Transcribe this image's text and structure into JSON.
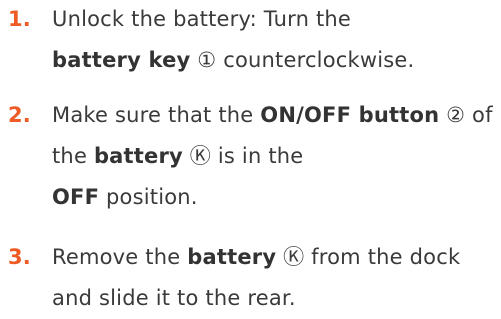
{
  "accent_color": "#ef5b24",
  "steps": [
    {
      "number": "1.",
      "parts": [
        {
          "text": "Unlock the battery: Turn the ",
          "bold": false
        },
        {
          "text": "battery key",
          "bold": true
        },
        {
          "text": " ① counterclockwise.",
          "bold": false
        }
      ]
    },
    {
      "number": "2.",
      "parts": [
        {
          "text": "Make sure that the ",
          "bold": false
        },
        {
          "text": "ON/OFF button",
          "bold": true
        },
        {
          "text": " ② of the ",
          "bold": false
        },
        {
          "text": "battery",
          "bold": true
        },
        {
          "text": " Ⓚ is in the ",
          "bold": false
        },
        {
          "text": "OFF",
          "bold": true
        },
        {
          "text": " position.",
          "bold": false
        }
      ]
    },
    {
      "number": "3.",
      "parts": [
        {
          "text": "Remove the ",
          "bold": false
        },
        {
          "text": "battery",
          "bold": true
        },
        {
          "text": " Ⓚ from the dock and slide it to the rear.",
          "bold": false
        }
      ]
    }
  ]
}
